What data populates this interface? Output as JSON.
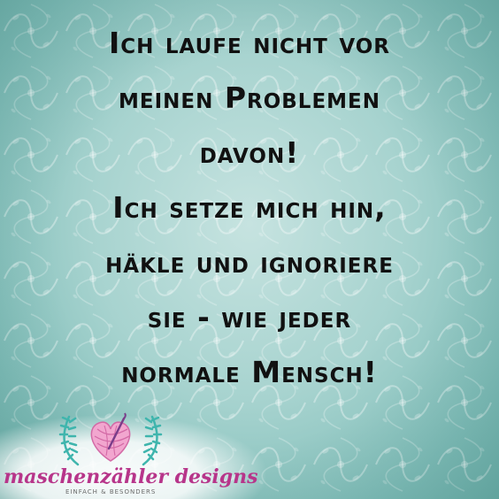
{
  "quote": {
    "lines": [
      "Ich laufe nicht vor",
      "meinen Problemen",
      "davon!",
      "Ich setze mich hin,",
      "häkle und ignoriere",
      "sie - wie jeder",
      "normale Mensch!"
    ]
  },
  "logo": {
    "brand": "maschenzähler designs",
    "tagline": "EINFACH & BESONDERS",
    "icons": [
      "yarn-heart-icon",
      "laurel-left-icon",
      "laurel-right-icon"
    ]
  },
  "colors": {
    "background": "#a7d3cf",
    "text": "#111111",
    "brand": "#b7358a",
    "yarn": "#e58cbf",
    "laurel": "#3fb5ad"
  }
}
